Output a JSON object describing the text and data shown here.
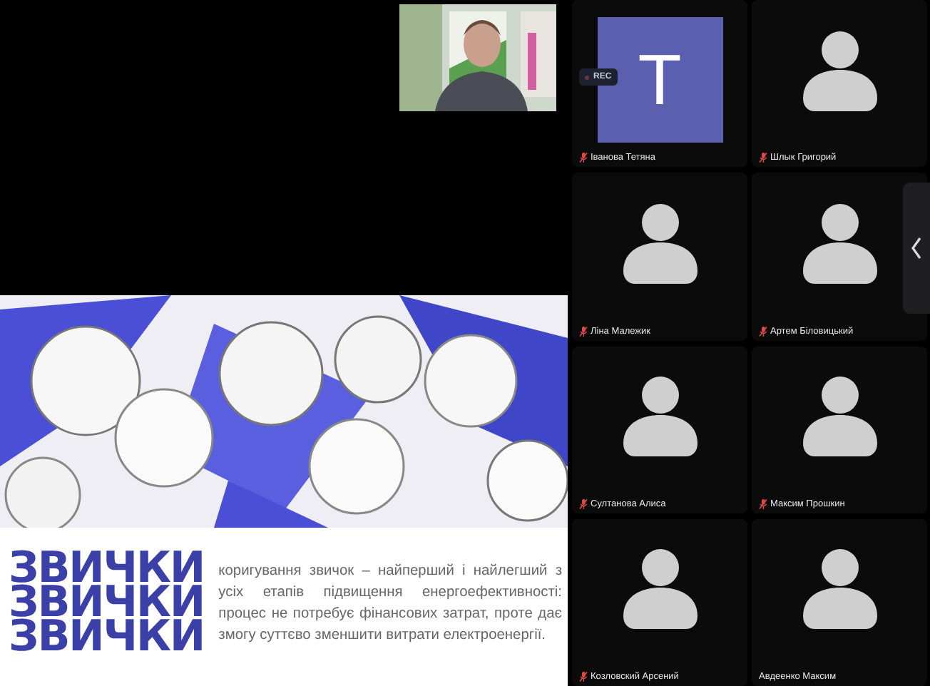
{
  "slide": {
    "headings": [
      "ЗВИЧКИ",
      "ЗВИЧКИ",
      "ЗВИЧКИ"
    ],
    "text": "коригування звичок – найперший і найлегший з усіх етапів підвищення енергоефективності: процес не потребує фінансових затрат, проте дає змогу суттєво зменшити витрати електроенергії."
  },
  "participants": [
    {
      "name": "Іванова Тетяна",
      "kind": "initial",
      "initial": "T",
      "muted": true,
      "badge": "REC"
    },
    {
      "name": "Шлык Григорий",
      "kind": "silhouette",
      "muted": true
    },
    {
      "name": "Ліна Малежик",
      "kind": "silhouette",
      "muted": true
    },
    {
      "name": "Артем Біловицький",
      "kind": "silhouette",
      "muted": true
    },
    {
      "name": "Султанова Алиса",
      "kind": "silhouette",
      "muted": true
    },
    {
      "name": "Максим Прошкин",
      "kind": "silhouette",
      "muted": true
    },
    {
      "name": "Козловский Арсений",
      "kind": "silhouette",
      "muted": true
    },
    {
      "name": "Авдеенко Максим",
      "kind": "silhouette",
      "muted": false
    }
  ]
}
